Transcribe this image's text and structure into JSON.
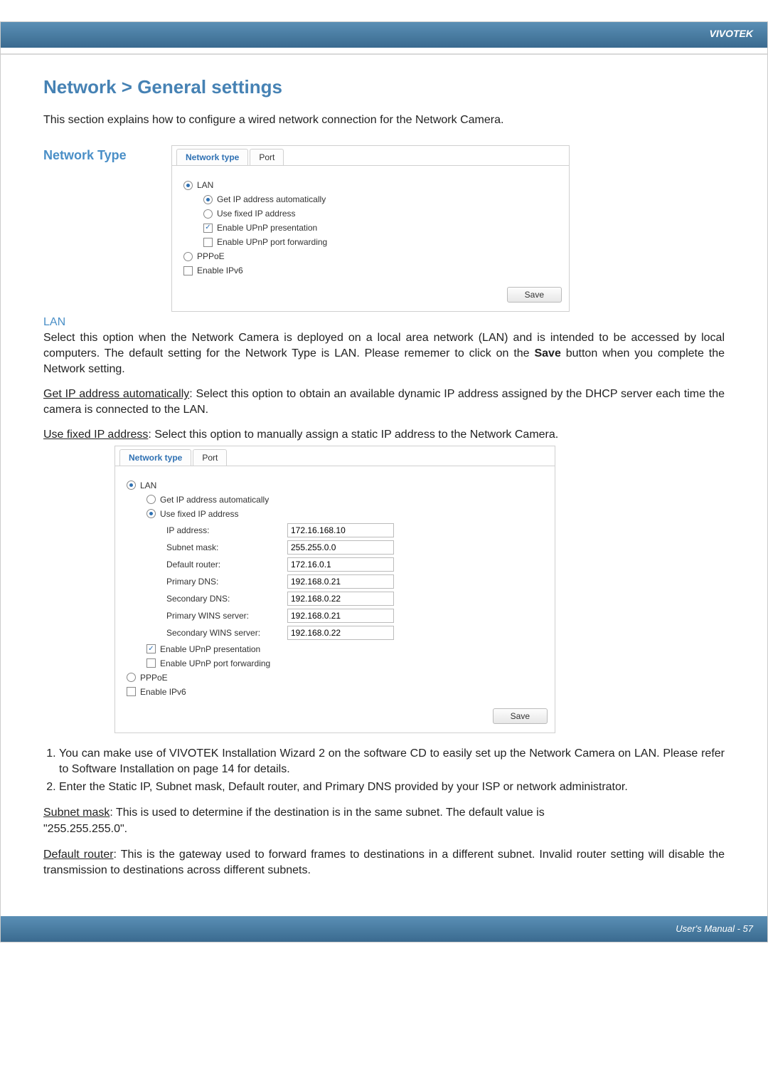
{
  "header": {
    "brand": "VIVOTEK"
  },
  "footer": {
    "text": "User's Manual - 57"
  },
  "title": "Network > General settings",
  "intro": "This section explains how to configure a wired network connection for the Network Camera.",
  "networkTypeLabel": "Network Type",
  "panel1": {
    "tabs": {
      "networkType": "Network type",
      "port": "Port"
    },
    "lan": "LAN",
    "getIpAuto": "Get IP address automatically",
    "useFixed": "Use fixed IP address",
    "upnpPresent": "Enable UPnP presentation",
    "upnpPortFwd": "Enable UPnP port forwarding",
    "pppoe": "PPPoE",
    "enableIpv6": "Enable IPv6",
    "save": "Save"
  },
  "lanSection": {
    "heading": "LAN",
    "para1_a": "Select this option when the Network Camera is deployed on a local area network (LAN) and is intended to be accessed by local computers. The default setting for the Network Type is LAN. Please rememer to click on the ",
    "para1_bold": "Save",
    "para1_b": " button when you complete the Network setting.",
    "getIpAuto_label": "Get IP address automatically",
    "getIpAuto_text": ": Select this option to obtain an available dynamic IP address assigned by the DHCP server each time the camera is connected to the LAN.",
    "useFixed_label": "Use fixed IP address",
    "useFixed_text": ": Select this option to manually assign a static IP address to the Network Camera."
  },
  "panel2": {
    "tabs": {
      "networkType": "Network type",
      "port": "Port"
    },
    "lan": "LAN",
    "getIpAuto": "Get IP address automatically",
    "useFixed": "Use fixed IP address",
    "fields": {
      "ipAddressLabel": "IP address:",
      "ipAddressValue": "172.16.168.10",
      "subnetLabel": "Subnet mask:",
      "subnetValue": "255.255.0.0",
      "routerLabel": "Default router:",
      "routerValue": "172.16.0.1",
      "primaryDnsLabel": "Primary DNS:",
      "primaryDnsValue": "192.168.0.21",
      "secondaryDnsLabel": "Secondary DNS:",
      "secondaryDnsValue": "192.168.0.22",
      "primaryWinsLabel": "Primary WINS server:",
      "primaryWinsValue": "192.168.0.21",
      "secondaryWinsLabel": "Secondary WINS server:",
      "secondaryWinsValue": "192.168.0.22"
    },
    "upnpPresent": "Enable UPnP presentation",
    "upnpPortFwd": "Enable UPnP port forwarding",
    "pppoe": "PPPoE",
    "enableIpv6": "Enable IPv6",
    "save": "Save"
  },
  "notes": {
    "n1": "You can make use of VIVOTEK Installation Wizard 2 on the software CD to easily set up the Network Camera on LAN. Please refer to Software Installation on page 14 for details.",
    "n2": "Enter the Static IP, Subnet mask, Default router, and Primary DNS provided by your ISP or network administrator."
  },
  "subnet": {
    "label": "Subnet mask",
    "text_a": ": This is used to determine if the destination is in the same subnet. The default value is",
    "text_b": "\"255.255.255.0\"."
  },
  "defaultRouter": {
    "label": "Default router",
    "text": ": This is the gateway used to forward frames to destinations in a different subnet. Invalid router setting will disable the transmission to destinations across different subnets."
  }
}
